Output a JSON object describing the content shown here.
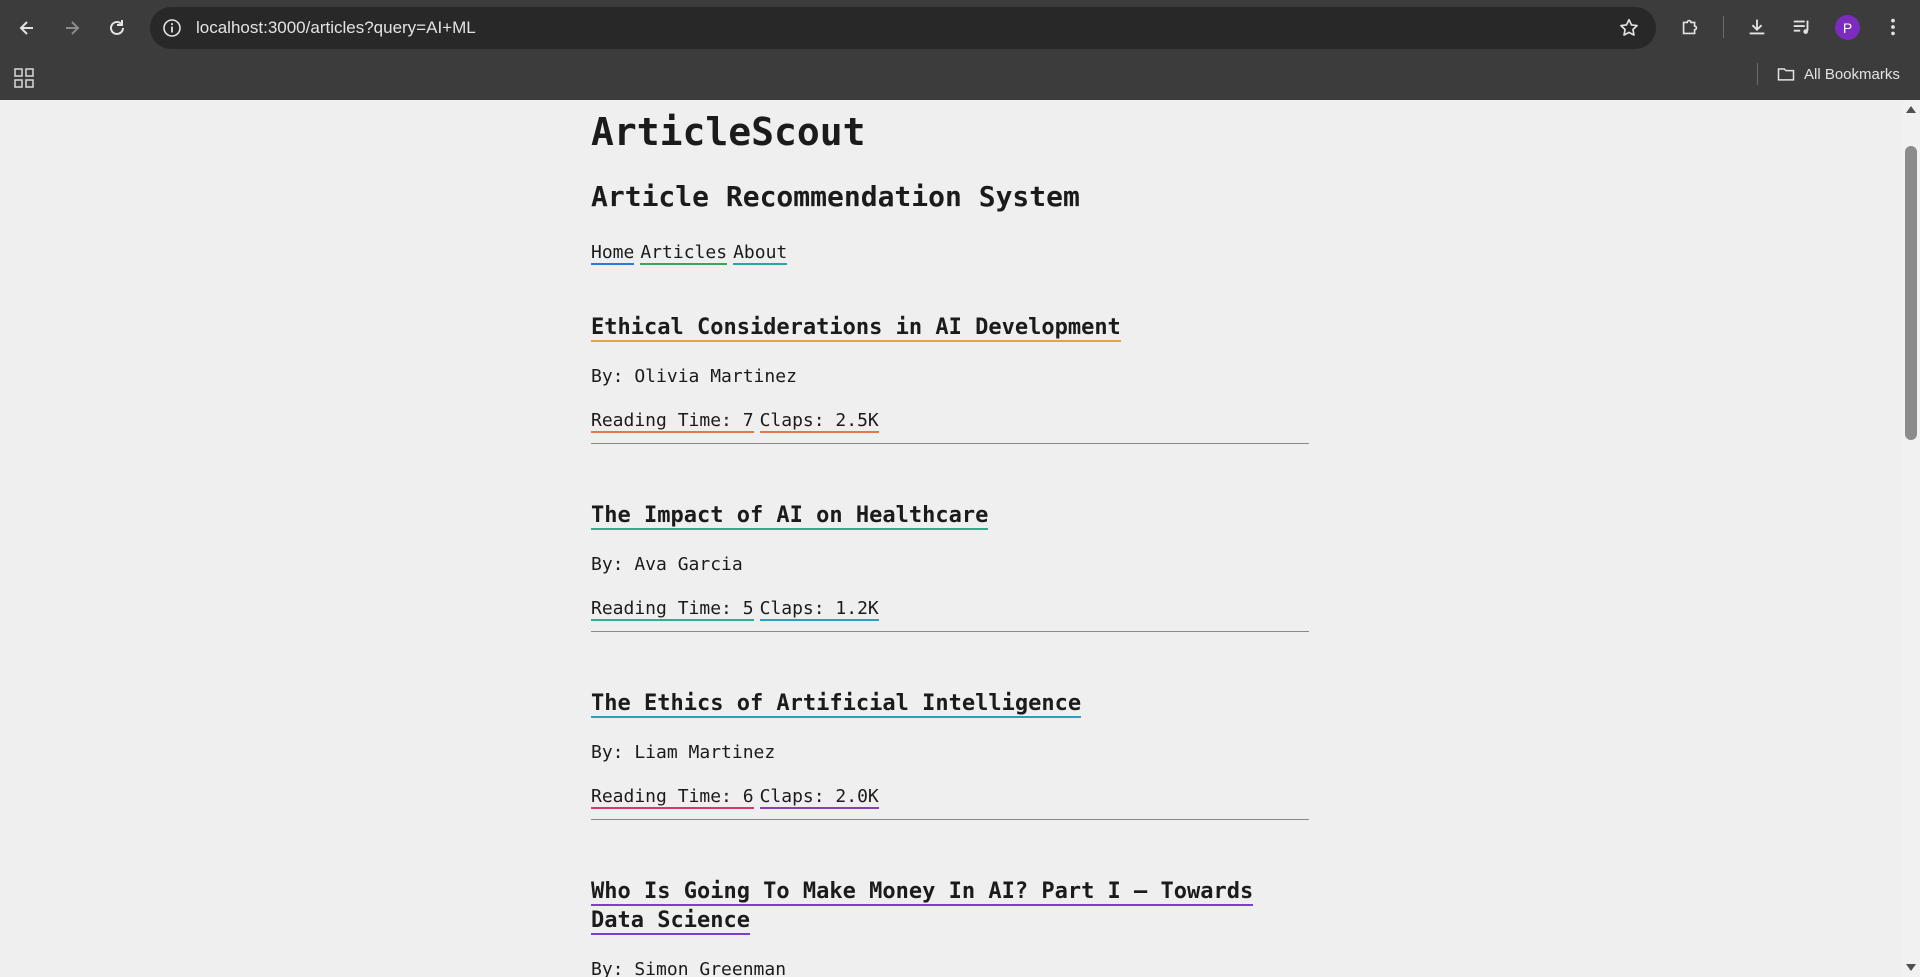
{
  "browser": {
    "url": "localhost:3000/articles?query=AI+ML",
    "profile_initial": "P",
    "bookmarks_label": "All Bookmarks"
  },
  "site": {
    "title": "ArticleScout",
    "subtitle": "Article Recommendation System",
    "nav": [
      "Home",
      "Articles",
      "About"
    ],
    "nav_colors": [
      "#2b7bd8",
      "#3aa655",
      "#2aa6a0"
    ]
  },
  "articles": [
    {
      "title": "Ethical Considerations in AI Development",
      "byline": "By: Olivia Martinez",
      "reading_time": "Reading Time: 7",
      "claps": "Claps: 2.5K",
      "colors": [
        "#e8a33a",
        "#e07a4a",
        "#e07a4a"
      ]
    },
    {
      "title": "The Impact of AI on Healthcare",
      "byline": "By: Ava Garcia",
      "reading_time": "Reading Time: 5",
      "claps": "Claps: 1.2K",
      "colors": [
        "#2fae8e",
        "#2fae9a",
        "#2a9fc0"
      ]
    },
    {
      "title": "The Ethics of Artificial Intelligence",
      "byline": "By: Liam Martinez",
      "reading_time": "Reading Time: 6",
      "claps": "Claps: 2.0K",
      "colors": [
        "#2a9fc0",
        "#d8376e",
        "#8a3fb8"
      ]
    },
    {
      "title": "Who Is Going To Make Money In AI? Part I – Towards Data Science",
      "byline": "By: Simon Greenman",
      "reading_time": "",
      "claps": "",
      "colors": [
        "#7a3fd0",
        "#7a3fd0",
        "#7a3fd0"
      ]
    }
  ]
}
